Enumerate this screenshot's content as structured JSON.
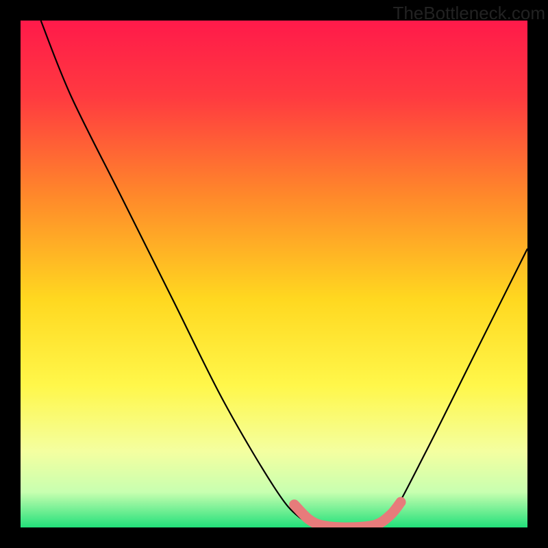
{
  "watermark": "TheBottleneck.com",
  "chart_data": {
    "type": "line",
    "title": "",
    "xlabel": "",
    "ylabel": "",
    "xlim": [
      0,
      100
    ],
    "ylim": [
      0,
      100
    ],
    "background_gradient": {
      "stops": [
        {
          "offset": 0.0,
          "color": "#ff1a4a"
        },
        {
          "offset": 0.15,
          "color": "#ff3a40"
        },
        {
          "offset": 0.35,
          "color": "#ff8a2a"
        },
        {
          "offset": 0.55,
          "color": "#ffd820"
        },
        {
          "offset": 0.72,
          "color": "#fff74a"
        },
        {
          "offset": 0.85,
          "color": "#f4ffa0"
        },
        {
          "offset": 0.93,
          "color": "#c8ffb0"
        },
        {
          "offset": 1.0,
          "color": "#22e07a"
        }
      ]
    },
    "series": [
      {
        "name": "curve",
        "color": "#000000",
        "width": 2.2,
        "points": [
          {
            "x": 4,
            "y": 100
          },
          {
            "x": 10,
            "y": 85
          },
          {
            "x": 20,
            "y": 65
          },
          {
            "x": 30,
            "y": 45
          },
          {
            "x": 40,
            "y": 25
          },
          {
            "x": 50,
            "y": 8
          },
          {
            "x": 55,
            "y": 2
          },
          {
            "x": 60,
            "y": 0
          },
          {
            "x": 65,
            "y": 0
          },
          {
            "x": 70,
            "y": 0.5
          },
          {
            "x": 73,
            "y": 2
          },
          {
            "x": 80,
            "y": 15
          },
          {
            "x": 90,
            "y": 35
          },
          {
            "x": 100,
            "y": 55
          }
        ]
      },
      {
        "name": "highlight",
        "color": "#e77b7b",
        "width": 15,
        "linecap": "round",
        "points": [
          {
            "x": 54,
            "y": 4.5
          },
          {
            "x": 57,
            "y": 1.5
          },
          {
            "x": 60,
            "y": 0.3
          },
          {
            "x": 65,
            "y": 0
          },
          {
            "x": 70,
            "y": 0.5
          },
          {
            "x": 73,
            "y": 2.5
          },
          {
            "x": 75,
            "y": 5.0
          }
        ]
      }
    ]
  }
}
